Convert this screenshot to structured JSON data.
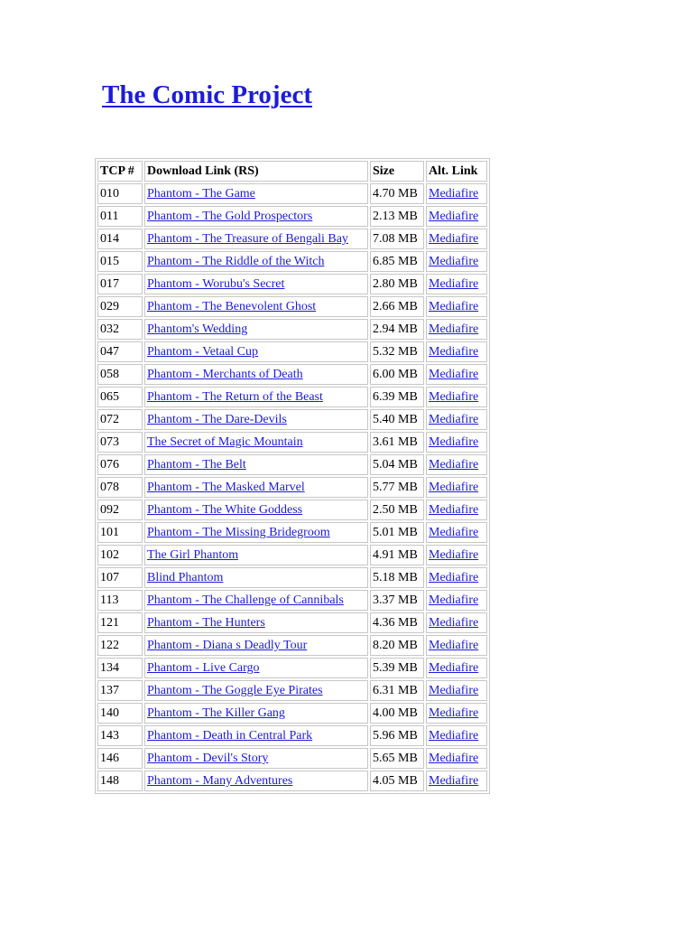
{
  "title": "The Comic Project",
  "table": {
    "headers": [
      "TCP #",
      "Download Link (RS)",
      "Size",
      "Alt. Link"
    ],
    "rows": [
      {
        "tcp": "010",
        "title": "Phantom - The Game",
        "size": "4.70 MB",
        "alt": "Mediafire"
      },
      {
        "tcp": "011",
        "title": "Phantom - The Gold Prospectors",
        "size": "2.13 MB",
        "alt": "Mediafire"
      },
      {
        "tcp": "014",
        "title": "Phantom - The Treasure of Bengali Bay",
        "size": "7.08 MB",
        "alt": "Mediafire"
      },
      {
        "tcp": "015",
        "title": "Phantom - The Riddle of the Witch",
        "size": "6.85 MB",
        "alt": "Mediafire"
      },
      {
        "tcp": "017",
        "title": "Phantom - Worubu's Secret",
        "size": "2.80 MB",
        "alt": "Mediafire"
      },
      {
        "tcp": "029",
        "title": "Phantom - The Benevolent Ghost",
        "size": "2.66 MB",
        "alt": "Mediafire"
      },
      {
        "tcp": "032",
        "title": "Phantom's Wedding",
        "size": "2.94 MB",
        "alt": "Mediafire"
      },
      {
        "tcp": "047",
        "title": "Phantom - Vetaal Cup",
        "size": "5.32 MB",
        "alt": "Mediafire"
      },
      {
        "tcp": "058",
        "title": "Phantom - Merchants of Death",
        "size": "6.00 MB",
        "alt": "Mediafire"
      },
      {
        "tcp": "065",
        "title": "Phantom - The Return of the Beast",
        "size": "6.39 MB",
        "alt": "Mediafire"
      },
      {
        "tcp": "072",
        "title": "Phantom - The Dare-Devils",
        "size": "5.40 MB",
        "alt": "Mediafire"
      },
      {
        "tcp": "073",
        "title": "The Secret of Magic Mountain",
        "size": "3.61 MB",
        "alt": "Mediafire"
      },
      {
        "tcp": "076",
        "title": "Phantom - The Belt",
        "size": "5.04 MB",
        "alt": "Mediafire"
      },
      {
        "tcp": "078",
        "title": "Phantom - The Masked Marvel",
        "size": "5.77 MB",
        "alt": "Mediafire"
      },
      {
        "tcp": "092",
        "title": "Phantom - The White Goddess",
        "size": "2.50 MB",
        "alt": "Mediafire"
      },
      {
        "tcp": "101",
        "title": "Phantom - The Missing Bridegroom",
        "size": "5.01 MB",
        "alt": "Mediafire"
      },
      {
        "tcp": "102",
        "title": "The Girl Phantom",
        "size": "4.91 MB",
        "alt": "Mediafire"
      },
      {
        "tcp": "107",
        "title": "Blind Phantom",
        "size": "5.18 MB",
        "alt": "Mediafire"
      },
      {
        "tcp": "113",
        "title": "Phantom - The Challenge of Cannibals",
        "size": "3.37 MB",
        "alt": "Mediafire"
      },
      {
        "tcp": "121",
        "title": "Phantom - The Hunters",
        "size": "4.36 MB",
        "alt": "Mediafire"
      },
      {
        "tcp": "122",
        "title": "Phantom - Diana s Deadly Tour",
        "size": "8.20 MB",
        "alt": "Mediafire"
      },
      {
        "tcp": "134",
        "title": "Phantom - Live Cargo",
        "size": "5.39 MB",
        "alt": "Mediafire"
      },
      {
        "tcp": "137",
        "title": "Phantom - The Goggle Eye Pirates",
        "size": "6.31 MB",
        "alt": "Mediafire"
      },
      {
        "tcp": "140",
        "title": "Phantom - The Killer Gang",
        "size": "4.00 MB",
        "alt": "Mediafire"
      },
      {
        "tcp": "143",
        "title": "Phantom - Death in Central Park",
        "size": "5.96 MB",
        "alt": "Mediafire"
      },
      {
        "tcp": "146",
        "title": "Phantom - Devil's Story",
        "size": "5.65 MB",
        "alt": "Mediafire"
      },
      {
        "tcp": "148",
        "title": "Phantom - Many Adventures",
        "size": "4.05 MB",
        "alt": "Mediafire"
      }
    ]
  },
  "colors": {
    "link": "#1c1cd6",
    "border": "#c6c6c6",
    "background": "#ffffff"
  }
}
